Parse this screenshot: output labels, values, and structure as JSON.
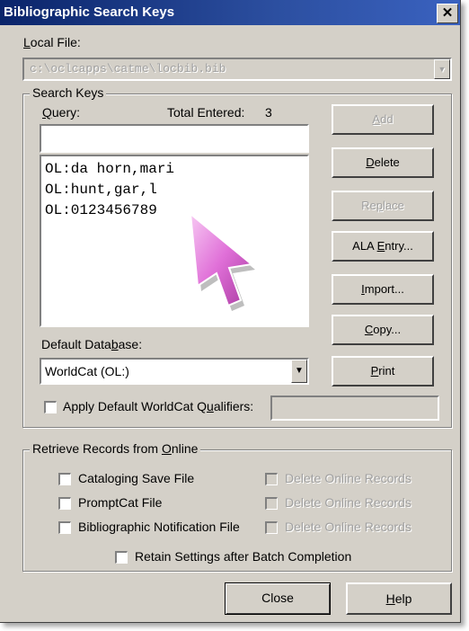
{
  "window": {
    "title": "Bibliographic Search Keys",
    "close_glyph": "✕"
  },
  "local_file": {
    "label_hotkey": "L",
    "label_rest": "ocal File:",
    "value": "c:\\oclcapps\\catme\\locbib.bib"
  },
  "search_keys": {
    "group_label": "Search Keys",
    "query_hotkey": "Q",
    "query_rest": "uery:",
    "query_value": "",
    "total_label": "Total Entered:",
    "total_value": "3",
    "entries": [
      "OL:da horn,mari",
      "OL:hunt,gar,l",
      "OL:0123456789"
    ]
  },
  "buttons": {
    "add": {
      "pre": "",
      "hotkey": "A",
      "post": "dd"
    },
    "delete": {
      "pre": "",
      "hotkey": "D",
      "post": "elete"
    },
    "replace": {
      "pre": "Re",
      "hotkey": "p",
      "post": "lace"
    },
    "ala_entry": {
      "pre": "ALA ",
      "hotkey": "E",
      "post": "ntry..."
    },
    "import": {
      "pre": "",
      "hotkey": "I",
      "post": "mport..."
    },
    "copy": {
      "pre": "",
      "hotkey": "C",
      "post": "opy..."
    },
    "print": {
      "pre": "",
      "hotkey": "P",
      "post": "rint"
    },
    "close": {
      "label": "Close"
    },
    "help": {
      "pre": "",
      "hotkey": "H",
      "post": "elp"
    }
  },
  "default_database": {
    "label_pre": "Default Data",
    "label_hotkey": "b",
    "label_post": "ase:",
    "value": "WorldCat (OL:)"
  },
  "apply_qualifiers": {
    "label_pre": "Apply Default WorldCat Q",
    "label_hotkey": "u",
    "label_post": "alifiers:",
    "checked": false,
    "value": ""
  },
  "retrieve": {
    "group_pre": "Retrieve Records from ",
    "group_hotkey": "O",
    "group_post": "nline",
    "rows": [
      {
        "label": "Cataloging Save File",
        "delete_label": "Delete Online Records"
      },
      {
        "label": "PromptCat File",
        "delete_label": "Delete Online Records"
      },
      {
        "label": "Bibliographic Notification File",
        "delete_label": "Delete Online Records"
      }
    ],
    "retain_label": "Retain Settings after Batch Completion"
  },
  "colors": {
    "dialog_bg": "#d4d0c8",
    "titlebar": "#0a246a",
    "pointer_fill": "#e070d8"
  },
  "icons": {
    "overlay": "pointer-arrow-icon",
    "dropdown": "chevron-down-icon"
  }
}
